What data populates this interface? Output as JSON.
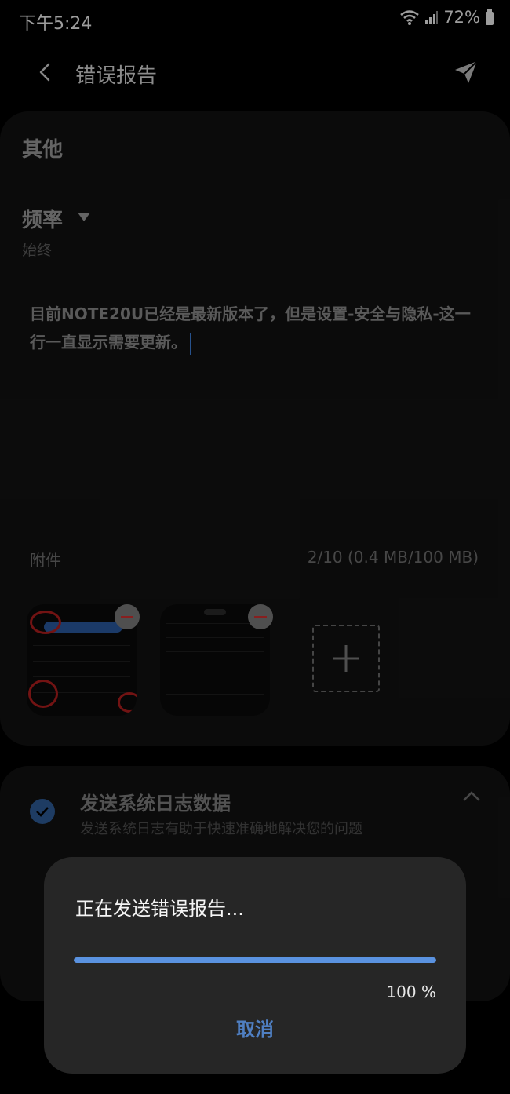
{
  "status_bar": {
    "time": "下午5:24",
    "battery": "72%",
    "icons": [
      "wifi-icon",
      "signal-icon",
      "battery-icon"
    ]
  },
  "app_bar": {
    "title": "错误报告",
    "back_icon": "chevron-left-icon",
    "send_icon": "send-icon"
  },
  "form": {
    "category": "其他",
    "frequency_label": "频率",
    "frequency_value": "始终",
    "report_text": "目前NOTE20U已经是最新版本了，但是设置-安全与隐私-这一行一直显示需要更新。",
    "attachments_label": "附件",
    "attachments_count": "2/10 (0.4 MB/100 MB)"
  },
  "log_option": {
    "title": "发送系统日志数据",
    "subtitle": "发送系统日志有助于快速准确地解决您的问题",
    "checked": true
  },
  "dialog": {
    "title": "正在发送错误报告...",
    "progress": 1.0,
    "progress_text": "100 %",
    "cancel_label": "取消"
  },
  "colors": {
    "accent": "#5a92e0",
    "cancel": "#4f7fc2",
    "check": "#2f5d99"
  }
}
